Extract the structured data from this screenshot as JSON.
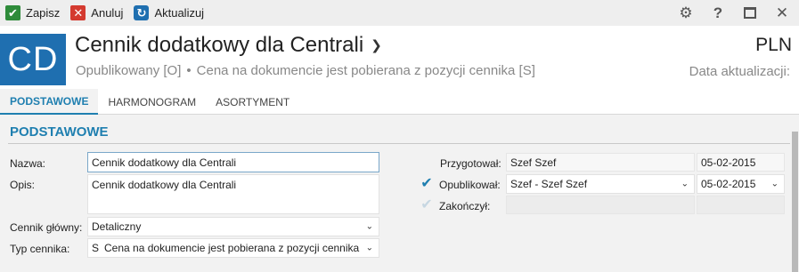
{
  "toolbar": {
    "save_label": "Zapisz",
    "cancel_label": "Anuluj",
    "refresh_label": "Aktualizuj",
    "right_icons": [
      "gear-icon",
      "help-icon",
      "maximize-icon",
      "close-icon"
    ]
  },
  "header": {
    "logo_text": "CD",
    "title": "Cennik dodatkowy dla Centrali",
    "status": "Opublikowany [O]",
    "separator": "•",
    "price_source": "Cena na dokumencie jest pobierana z pozycji cennika [S]",
    "currency": "PLN",
    "update_label": "Data aktualizacji:"
  },
  "tabs": [
    {
      "label": "PODSTAWOWE",
      "active": true
    },
    {
      "label": "HARMONOGRAM",
      "active": false
    },
    {
      "label": "ASORTYMENT",
      "active": false
    }
  ],
  "section": {
    "title": "PODSTAWOWE"
  },
  "form": {
    "name": {
      "label": "Nazwa:",
      "value": "Cennik dodatkowy dla Centrali"
    },
    "description": {
      "label": "Opis:",
      "value": "Cennik dodatkowy dla Centrali"
    },
    "main_pricelist": {
      "label": "Cennik główny:",
      "value": "Detaliczny"
    },
    "pricelist_type": {
      "label": "Typ cennika:",
      "code": "S",
      "value": "Cena na dokumencie jest pobierana z pozycji cennika"
    }
  },
  "status_panel": {
    "prepared": {
      "label": "Przygotował:",
      "user": "Szef Szef",
      "date": "05-02-2015"
    },
    "published": {
      "label": "Opublikował:",
      "user": "Szef - Szef Szef",
      "date": "05-02-2015",
      "checked": true
    },
    "closed": {
      "label": "Zakończył:",
      "user": "",
      "date": "",
      "checked": false
    }
  },
  "colors": {
    "accent": "#1f7fb0",
    "save_icon": "#2e8b3a",
    "cancel_icon": "#d43a2f",
    "logo_bg": "#1f6fb0"
  }
}
